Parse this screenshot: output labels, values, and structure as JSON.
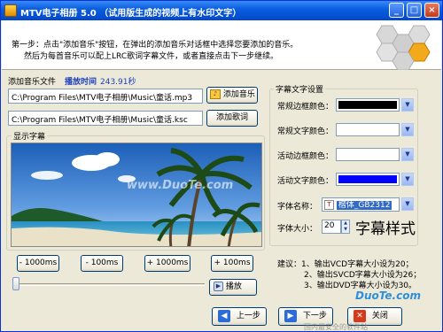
{
  "window": {
    "title": "MTV电子相册 5.0 （试用版生成的视频上有水印文字）",
    "min_label": "_",
    "max_label": "□",
    "close_label": "×"
  },
  "header": {
    "step_line1": "第一步：点击\"添加音乐\"按钮，在弹出的添加音乐对话框中选择您要添加的音乐。",
    "step_line2": "然后为每首音乐可以配上LRC歌词字幕文件，或者直接点击下一步继续。"
  },
  "music": {
    "file_label": "添加音乐文件",
    "duration_label": "播放时间",
    "duration_value": "243.91秒",
    "music_path": "C:\\Program Files\\MTV电子相册\\Music\\童话.mp3",
    "lyrics_path": "C:\\Program Files\\MTV电子相册\\Music\\童话.ksc",
    "add_music_button": "添加音乐",
    "add_lyrics_button": "添加歌词"
  },
  "preview": {
    "group_title": "显示字幕",
    "watermark": "www.DuoTe.com"
  },
  "timing": {
    "minus_1000": "- 1000ms",
    "minus_100": "- 100ms",
    "plus_1000": "+ 1000ms",
    "plus_100": "+ 100ms",
    "play_button": "播放",
    "progress": 0
  },
  "style_settings": {
    "group_title": "字幕文字设置",
    "normal_border_label": "常规边框颜色：",
    "normal_border_color": "#000000",
    "normal_text_label": "常规文字颜色：",
    "normal_text_color": "#ffffff",
    "active_border_label": "活动边框颜色：",
    "active_border_color": "#ffffff",
    "active_text_label": "活动文字颜色：",
    "active_text_color": "#0000ff",
    "font_name_label": "字体名称：",
    "font_name_value": "楷体_GB2312",
    "font_size_label": "字体大小：",
    "font_size_value": "20",
    "preview_text": "字幕样式"
  },
  "suggestions": {
    "line1": "建议：1、输出VCD字幕大小设为20；",
    "line2": "2、输出SVCD字幕大小设为26；",
    "line3": "3、输出DVD字幕大小设为30。"
  },
  "footer": {
    "prev_button": "上一步",
    "next_button": "下一步",
    "close_button": "关闭",
    "watermark_site": "DuoTe.com",
    "watermark_tagline": "国内最安全的软件站"
  },
  "colors": {
    "title_blue": "#0a5fe0",
    "accent_blue": "#1d3fbf",
    "window_bg": "#ece9d8"
  }
}
